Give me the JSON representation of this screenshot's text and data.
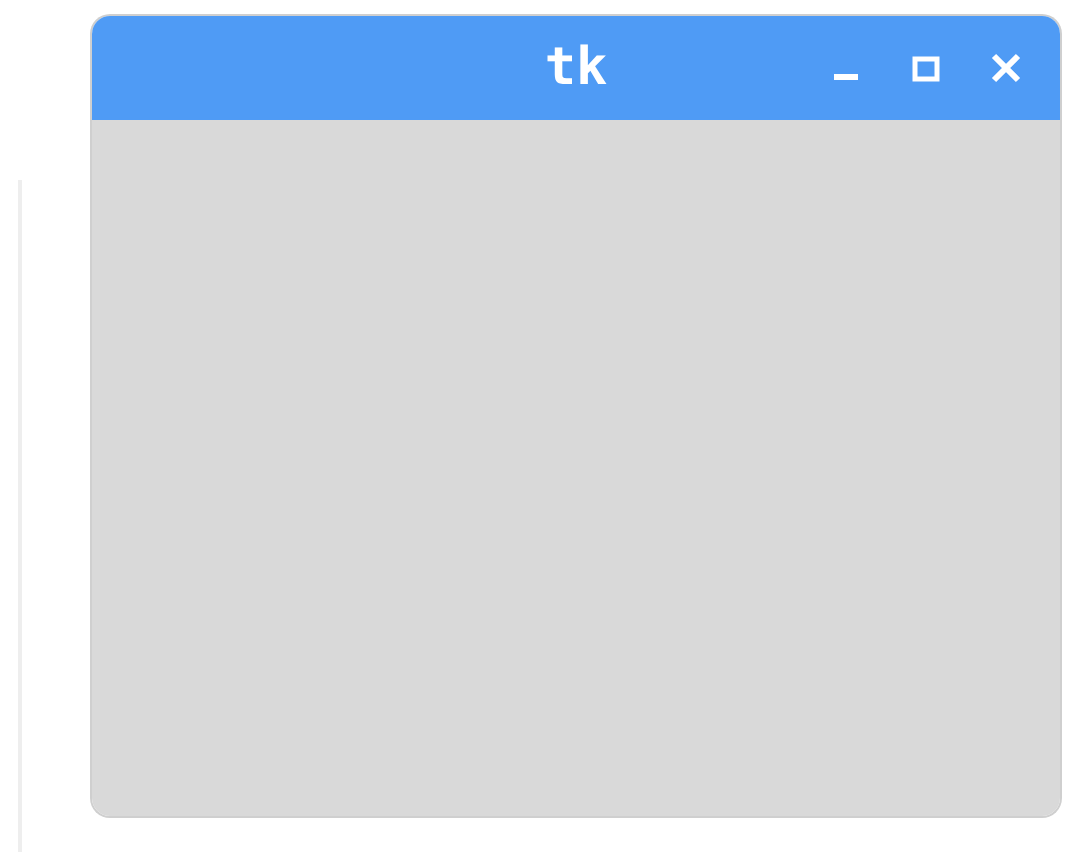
{
  "window": {
    "title": "tk"
  }
}
